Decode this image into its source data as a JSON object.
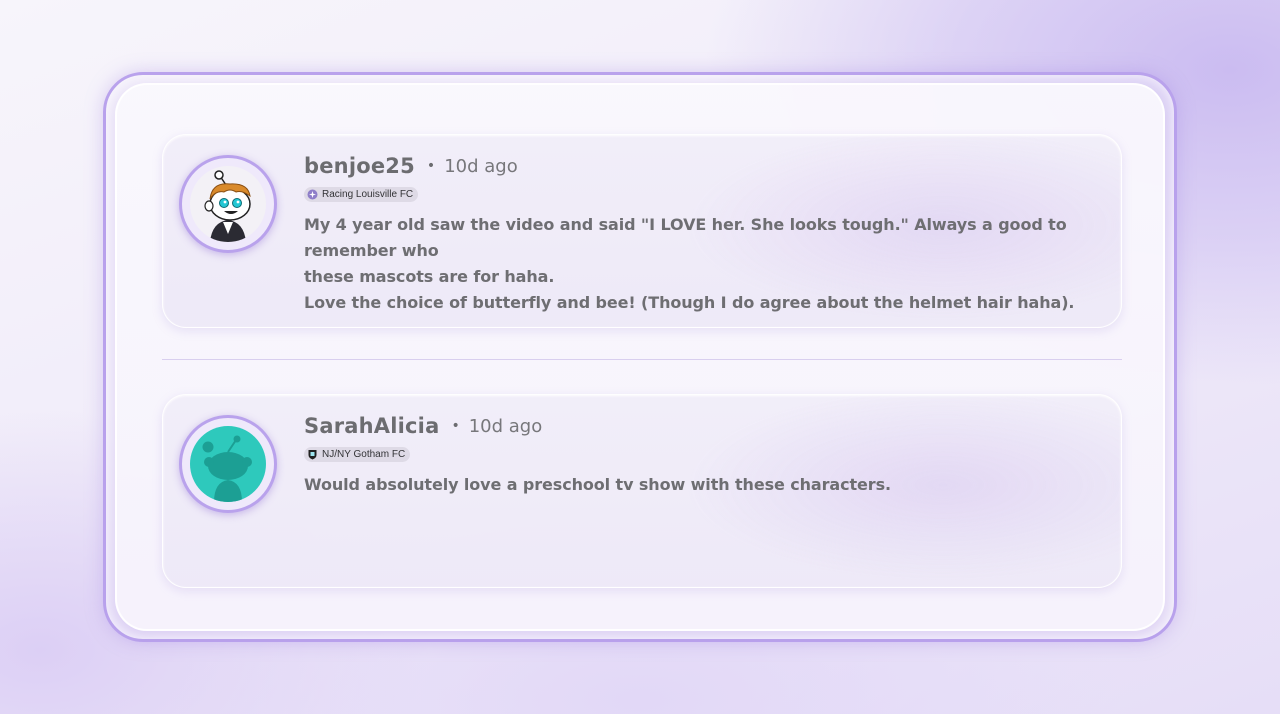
{
  "comments": [
    {
      "username": "benjoe25",
      "separator": "•",
      "time": "10d ago",
      "flair": "Racing Louisville FC",
      "avatar": "snoo-avatar-costume-icon",
      "body_lines": [
        "My 4 year old saw the video and said \"I LOVE her. She looks tough.\" Always a good to",
        "remember who",
        "these mascots are for haha.",
        "Love the choice of butterfly and bee! (Though I do agree about the helmet hair haha)."
      ]
    },
    {
      "username": "SarahAlicia",
      "separator": "•",
      "time": "10d ago",
      "flair": "NJ/NY Gotham FC",
      "avatar": "snoo-default-avatar-icon",
      "body_lines": [
        "Would absolutely love a preschool tv show with these characters."
      ]
    }
  ],
  "colors": {
    "frame_border": "#b9a2ec",
    "avatar_teal": "#2ec9bc",
    "text_gray": "#6e6e72"
  }
}
